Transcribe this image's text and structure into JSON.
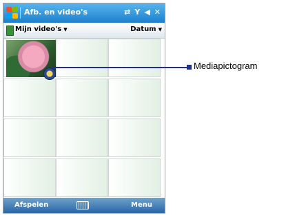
{
  "titlebar": {
    "title": "Afb. en video's",
    "icons": {
      "sync": "⇄",
      "signal": "Y",
      "volume": "◀",
      "close": "✕"
    }
  },
  "toolbar": {
    "folder": "Mijn video's",
    "sort": "Datum"
  },
  "softkeys": {
    "left": "Afspelen",
    "right": "Menu"
  },
  "callout": {
    "label": "Mediapictogram"
  }
}
